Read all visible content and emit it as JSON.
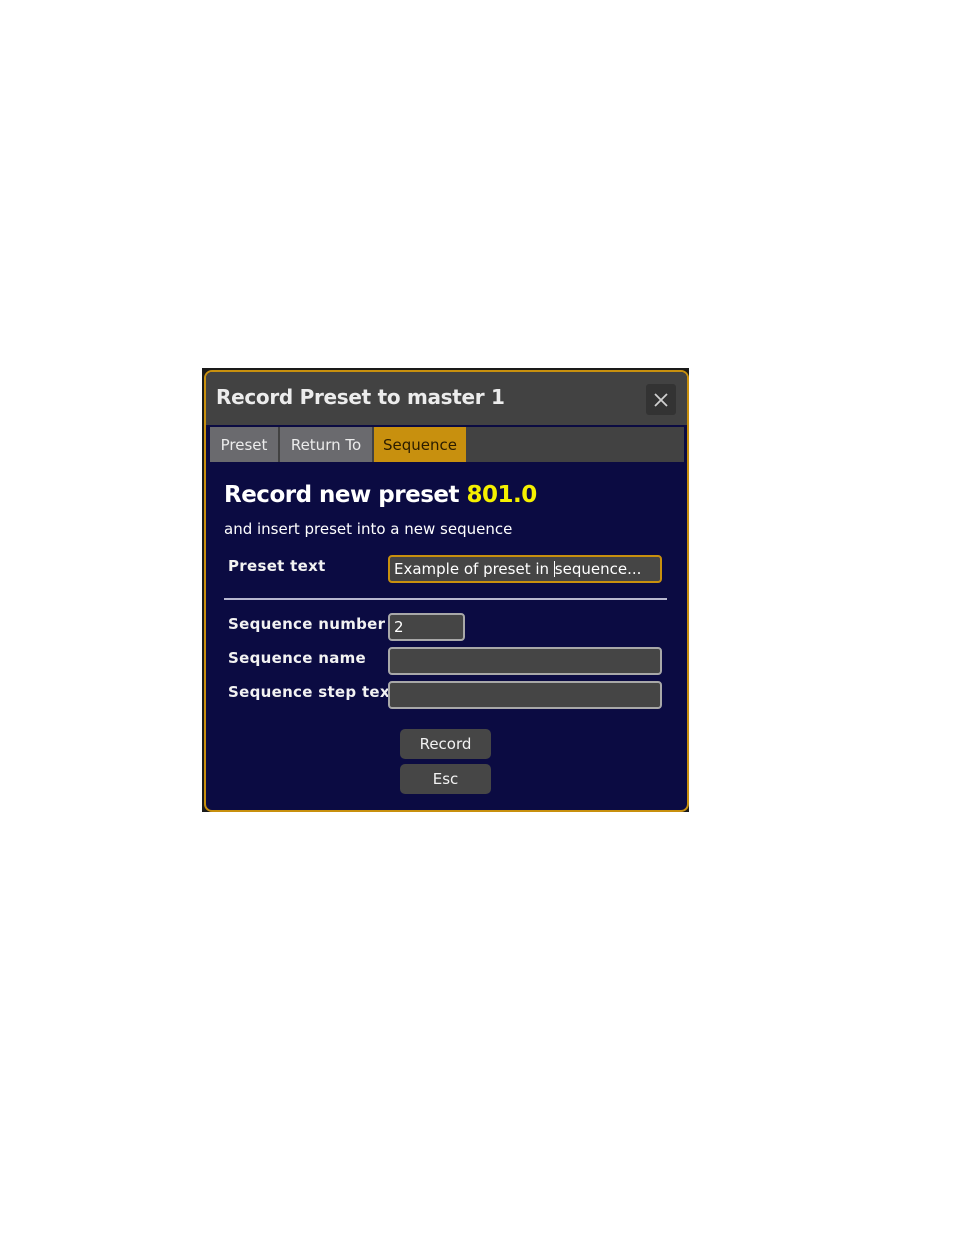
{
  "dialog": {
    "title": "Record Preset to master 1",
    "close_icon": "close-icon"
  },
  "tabs": [
    {
      "label": "Preset",
      "active": false
    },
    {
      "label": "Return To",
      "active": false
    },
    {
      "label": "Sequence",
      "active": true
    }
  ],
  "content": {
    "heading_prefix": "Record new preset",
    "preset_number": "801.0",
    "subheading": "and insert preset into a new sequence",
    "preset_text": {
      "label": "Preset text",
      "value_before_caret": "Example of preset in ",
      "value_after_caret": "sequence..."
    },
    "sequence_number": {
      "label": "Sequence number",
      "value": "2"
    },
    "sequence_name": {
      "label": "Sequence name",
      "value": ""
    },
    "sequence_step_text": {
      "label": "Sequence step text",
      "value": ""
    }
  },
  "buttons": {
    "record": "Record",
    "esc": "Esc"
  },
  "colors": {
    "accent": "#c8900e",
    "background": "#0b0b42",
    "titlebar": "#424242",
    "preset_number": "#f5f000"
  }
}
